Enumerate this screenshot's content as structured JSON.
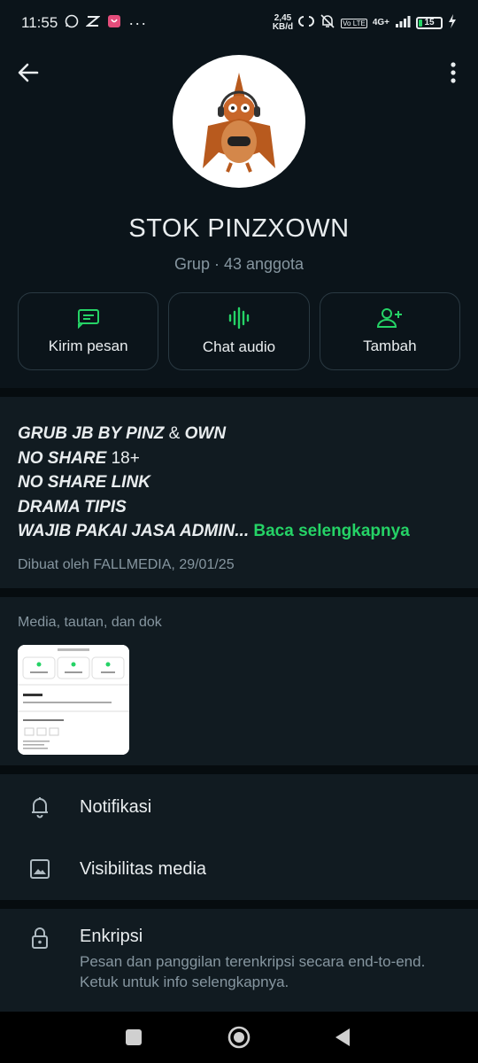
{
  "status_bar": {
    "time": "11:55",
    "net_speed_value": "2,45",
    "net_speed_unit": "KB/d",
    "volte": "Vo LTE",
    "network": "4G+",
    "battery": "15",
    "battery_level": 0.15
  },
  "header": {
    "group_name": "STOK PINZXOWN",
    "group_subtitle": "Grup · 43 anggota"
  },
  "actions": [
    {
      "label": "Kirim pesan",
      "icon": "message-icon"
    },
    {
      "label": "Chat audio",
      "icon": "audio-wave-icon"
    },
    {
      "label": "Tambah",
      "icon": "add-person-icon"
    }
  ],
  "description": {
    "line1_bold": "GRUB JB BY PINZ",
    "line1_amp": " & ",
    "line1_bold2": "OWN",
    "line2_bold": "NO SHARE",
    "line2_rest": " 18+",
    "line3": "NO SHARE LINK",
    "line4": "DRAMA TIPIS",
    "line5": "WAJIB PAKAI JASA ADMIN",
    "ellipsis": "... ",
    "read_more": "Baca selengkapnya",
    "created": "Dibuat oleh FALLMEDIA, 29/01/25"
  },
  "media": {
    "title": "Media, tautan, dan dok"
  },
  "settings": [
    {
      "label": "Notifikasi",
      "icon": "bell-icon"
    },
    {
      "label": "Visibilitas media",
      "icon": "image-icon"
    }
  ],
  "encryption": {
    "title": "Enkripsi",
    "subtitle": "Pesan dan panggilan terenkripsi secara end-to-end. Ketuk untuk info selengkapnya."
  },
  "colors": {
    "background": "#0b141a",
    "accent": "#25d366",
    "secondary_text": "#8696a0"
  }
}
